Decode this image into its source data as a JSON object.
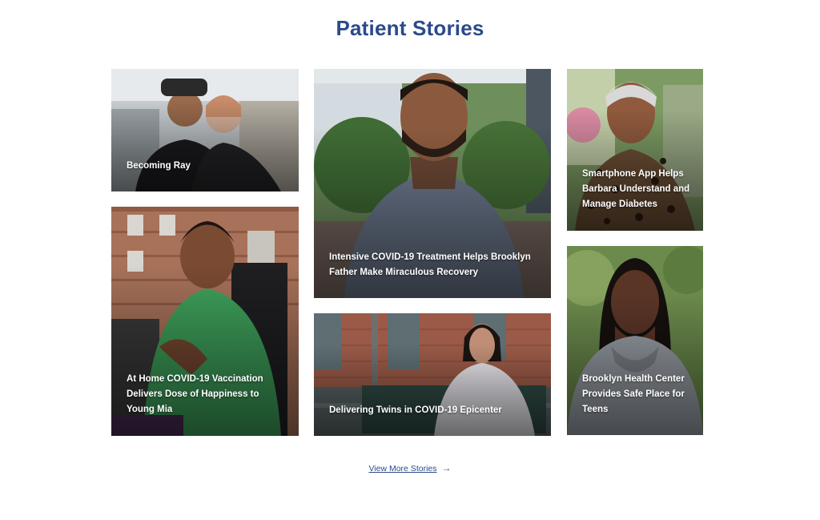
{
  "section": {
    "title": "Patient Stories"
  },
  "stories": [
    {
      "id": "becoming-ray",
      "caption": "Becoming Ray"
    },
    {
      "id": "covid-treatment",
      "caption": "Intensive COVID-19 Treatment Helps Brooklyn Father Make Miraculous Recovery"
    },
    {
      "id": "smartphone-app",
      "caption": "Smartphone App Helps Barbara Understand and Manage Diabetes"
    },
    {
      "id": "home-vaccination",
      "caption": "At Home COVID-19 Vaccination Delivers Dose of Happiness to Young Mia"
    },
    {
      "id": "delivering-twins",
      "caption": "Delivering Twins in COVID-19 Epicenter"
    },
    {
      "id": "brooklyn-health",
      "caption": "Brooklyn Health Center Provides Safe Place for Teens"
    }
  ],
  "view_more": {
    "label": "View More Stories",
    "icon": "arrow-right-icon"
  },
  "colors": {
    "title": "#2b4a8b",
    "link": "#2b4a8b",
    "caption_text": "#ffffff"
  }
}
